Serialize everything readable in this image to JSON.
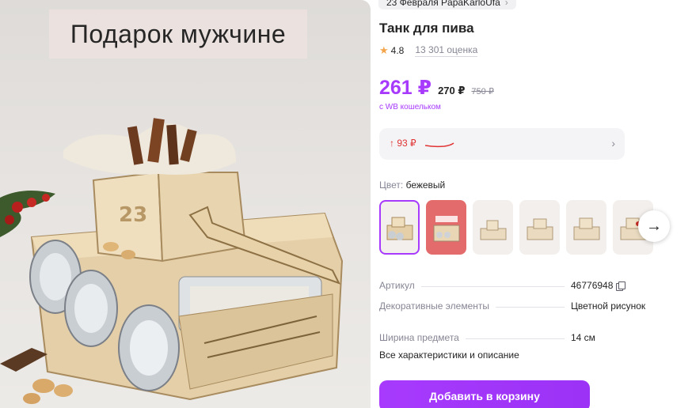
{
  "breadcrumb": {
    "label": "23 Февраля PapaKarloUfa",
    "chevron": "›"
  },
  "image": {
    "caption": "Подарок мужчине"
  },
  "product": {
    "title": "Танк для пива",
    "rating": "4.8",
    "reviews": "13 301 оценка"
  },
  "price": {
    "main": "261 ₽",
    "card": "270 ₽",
    "old": "750 ₽",
    "wallet_note": "с WB кошельком",
    "accent_color": "#a73afd"
  },
  "price_history": {
    "delta": "↑ 93 ₽",
    "chevron": "›"
  },
  "color": {
    "label": "Цвет:",
    "value": "бежевый"
  },
  "swatches": {
    "count_visible": 6,
    "selected_index": 0,
    "next_icon": "arrow-right-icon"
  },
  "specs": [
    {
      "key": "Артикул",
      "value": "46776948",
      "copyable": true
    },
    {
      "key": "Декоративные элементы",
      "value": "Цветной рисунок"
    },
    {
      "key": "Ширина предмета",
      "value": "14 см"
    }
  ],
  "all_specs_link": "Все характеристики и описание",
  "cart_button": "Добавить в корзину"
}
